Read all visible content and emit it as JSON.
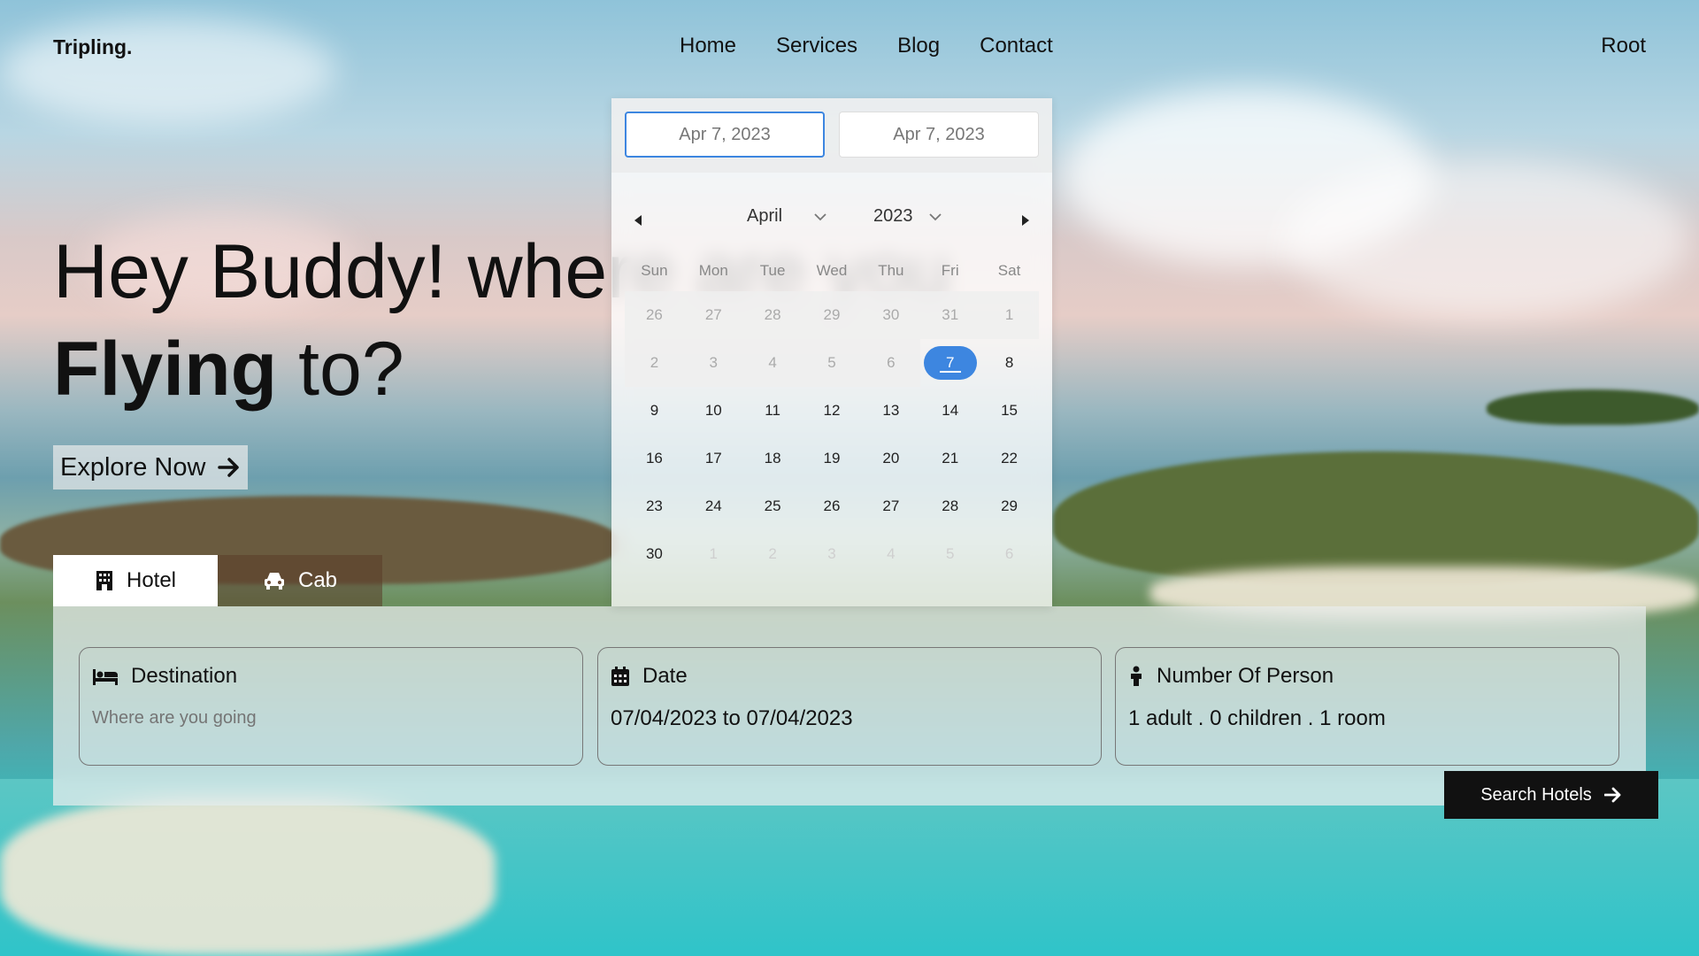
{
  "header": {
    "brand": "Tripling.",
    "nav": [
      "Home",
      "Services",
      "Blog",
      "Contact"
    ],
    "user": "Root"
  },
  "hero": {
    "line1": "Hey Buddy! where are you",
    "line2_bold": "Flying",
    "line2_rest": " to?",
    "explore_label": "Explore Now"
  },
  "tabs": [
    {
      "label": "Hotel",
      "icon": "building-icon",
      "active": true
    },
    {
      "label": "Cab",
      "icon": "car-icon",
      "active": false
    }
  ],
  "search": {
    "destination": {
      "label": "Destination",
      "icon": "bed-icon",
      "placeholder": "Where are you going"
    },
    "date": {
      "label": "Date",
      "icon": "calendar-icon",
      "value": "07/04/2023 to 07/04/2023"
    },
    "persons": {
      "label": "Number Of Person",
      "icon": "person-icon",
      "value": "1 adult . 0 children . 1 room"
    },
    "button_label": "Search Hotels"
  },
  "datepicker": {
    "start": "Apr 7, 2023",
    "end": "Apr 7, 2023",
    "month": "April",
    "year": "2023",
    "weekdays": [
      "Sun",
      "Mon",
      "Tue",
      "Wed",
      "Thu",
      "Fri",
      "Sat"
    ],
    "selected_day": "7",
    "weeks": [
      [
        "26",
        "27",
        "28",
        "29",
        "30",
        "31",
        "1"
      ],
      [
        "2",
        "3",
        "4",
        "5",
        "6",
        "7",
        "8"
      ],
      [
        "9",
        "10",
        "11",
        "12",
        "13",
        "14",
        "15"
      ],
      [
        "16",
        "17",
        "18",
        "19",
        "20",
        "21",
        "22"
      ],
      [
        "23",
        "24",
        "25",
        "26",
        "27",
        "28",
        "29"
      ],
      [
        "30",
        "1",
        "2",
        "3",
        "4",
        "5",
        "6"
      ]
    ]
  },
  "colors": {
    "accent": "#3d86e0",
    "dark": "#111111"
  }
}
